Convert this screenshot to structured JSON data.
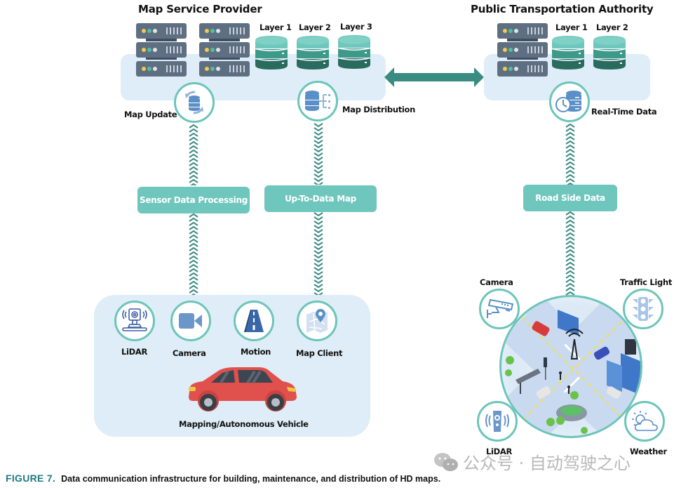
{
  "left_group": {
    "title": "Map Service Provider",
    "layers": [
      "Layer 1",
      "Layer 2",
      "Layer 3"
    ],
    "nodes": [
      {
        "label": "Map Update",
        "icon": "database-sync-icon",
        "flow": "up"
      },
      {
        "label": "Map Distribution",
        "icon": "database-distribution-icon",
        "flow": "down"
      }
    ]
  },
  "right_group": {
    "title": "Public Transportation Authority",
    "layers": [
      "Layer 1",
      "Layer 2"
    ],
    "node": {
      "label": "Real-Time Data",
      "icon": "clock-database-icon",
      "flow": "up"
    }
  },
  "link": {
    "type": "bidirectional-arrow"
  },
  "process_boxes": {
    "sensor": "Sensor Data Processing",
    "map": "Up-To-Data Map",
    "roadside": "Road Side Data"
  },
  "vehicle": {
    "title": "Mapping/Autonomous Vehicle",
    "sensors": [
      {
        "label": "LiDAR",
        "icon": "lidar-icon"
      },
      {
        "label": "Camera",
        "icon": "video-camera-icon"
      },
      {
        "label": "Motion",
        "icon": "road-icon"
      },
      {
        "label": "Map Client",
        "icon": "map-pin-icon"
      }
    ]
  },
  "city": {
    "sensors": [
      {
        "label": "Camera",
        "icon": "cctv-camera-icon"
      },
      {
        "label": "Traffic Light",
        "icon": "traffic-light-icon"
      },
      {
        "label": "LiDAR",
        "icon": "lidar-sensor-icon"
      },
      {
        "label": "Weather",
        "icon": "weather-icon"
      }
    ]
  },
  "colors": {
    "teal": "#3a8c82",
    "teal_light": "#6fc6bd",
    "panel_bg": "#deedf7",
    "server": "#5f6f82",
    "icon_blue": "#5b8fc7",
    "car_red": "#e0504c"
  },
  "caption": {
    "figure": "FIGURE 7.",
    "text": "Data communication infrastructure for building, maintenance, and distribution of HD maps."
  },
  "watermark": "公众号 · 自动驾驶之心"
}
